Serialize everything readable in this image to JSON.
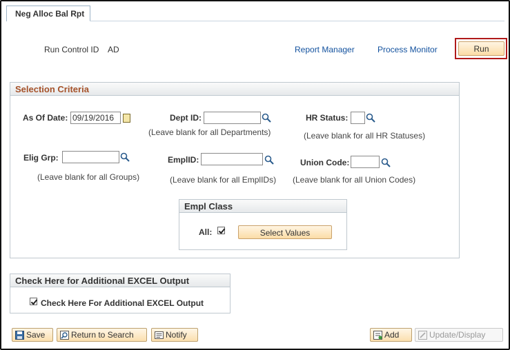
{
  "tab": {
    "label": "Neg Alloc Bal Rpt"
  },
  "run_control": {
    "label": "Run Control ID",
    "value": "AD"
  },
  "links": {
    "report_manager": "Report Manager",
    "process_monitor": "Process Monitor"
  },
  "run_button": "Run",
  "selection_criteria": {
    "title": "Selection Criteria",
    "as_of_date": {
      "label": "As Of Date:",
      "value": "09/19/2016"
    },
    "dept_id": {
      "label": "Dept ID:",
      "value": "",
      "hint": "(Leave blank for all Departments)"
    },
    "hr_status": {
      "label": "HR Status:",
      "value": "",
      "hint": "(Leave blank for all HR Statuses)"
    },
    "elig_grp": {
      "label": "Elig Grp:",
      "value": "",
      "hint": "(Leave blank for all Groups)"
    },
    "emplid": {
      "label": "EmplID:",
      "value": "",
      "hint": "(Leave blank for all EmplIDs)"
    },
    "union_code": {
      "label": "Union Code:",
      "value": "",
      "hint": "(Leave blank for all Union Codes)"
    },
    "empl_class": {
      "title": "Empl Class",
      "all_label": "All:",
      "all_checked": true,
      "select_values": "Select Values"
    }
  },
  "excel": {
    "title": "Check Here for Additional EXCEL Output",
    "checkbox_label": "Check Here For Additional EXCEL Output",
    "checked": true
  },
  "toolbar": {
    "save": "Save",
    "return_to_search": "Return to Search",
    "notify": "Notify",
    "add": "Add",
    "update_display": "Update/Display"
  },
  "colors": {
    "section_title": "#a5522a",
    "link": "#12519e",
    "highlight": "#b01a1a",
    "button": "#fbdca6"
  }
}
